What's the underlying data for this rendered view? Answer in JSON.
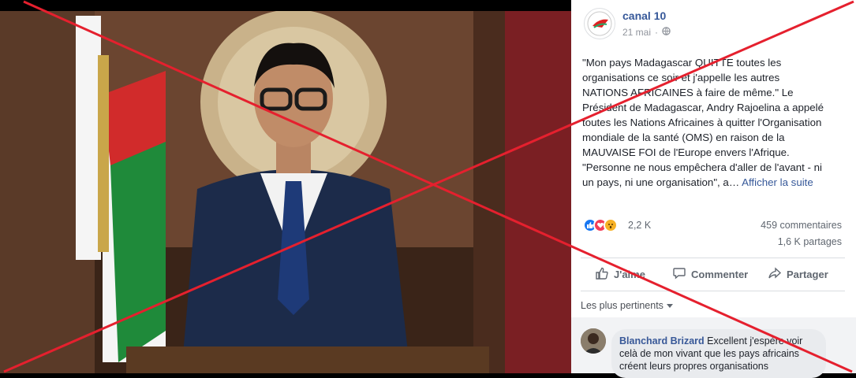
{
  "post": {
    "page_name": "canal 10",
    "date": "21 mai",
    "audience_icon": "globe-icon",
    "text_lines": [
      "\"Mon pays Madagascar QUITTE toutes les",
      "organisations ce soir et j'appelle les autres",
      "NATIONS AFRICAINES à faire de même.\" Le",
      "Président de Madagascar, Andry Rajoelina a appelé",
      "toutes les Nations Africaines à quitter l'Organisation",
      "mondiale de la santé (OMS) en raison de la",
      "MAUVAISE FOI de l'Europe envers l'Afrique.",
      "\"Personne ne nous empêchera d'aller de l'avant - ni",
      "un pays, ni une organisation\", a…"
    ],
    "see_more": "Afficher la suite"
  },
  "stats": {
    "reactions": "2,2 K",
    "comments": "459 commentaires",
    "shares": "1,6 K partages",
    "reaction_icons": [
      "like-reaction-icon",
      "love-reaction-icon",
      "wow-reaction-icon"
    ]
  },
  "actions": {
    "like": "J'aime",
    "comment": "Commenter",
    "share": "Partager"
  },
  "comments": {
    "sort_label": "Les plus pertinents",
    "first": {
      "author": "Blanchard Brizard",
      "text": " Excellent j'espère voir celà de mon vivant que les pays africains créent leurs propres organisations"
    }
  },
  "colors": {
    "link": "#365899",
    "cross": "#e5202e",
    "like": "#1877f2",
    "love": "#f33e58",
    "wow": "#f7b125"
  }
}
